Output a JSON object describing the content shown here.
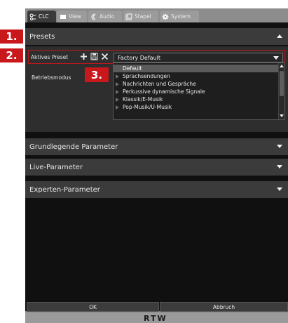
{
  "tabs": [
    {
      "label": "CLC",
      "icon": "clc-icon"
    },
    {
      "label": "View",
      "icon": "monitor-icon"
    },
    {
      "label": "Audio",
      "icon": "audio-icon"
    },
    {
      "label": "Stapel",
      "icon": "stack-icon"
    },
    {
      "label": "System",
      "icon": "gear-icon"
    }
  ],
  "sections": {
    "presets": "Presets",
    "basic": "Grundlegende Parameter",
    "live": "Live-Parameter",
    "expert": "Experten-Parameter"
  },
  "preset": {
    "label": "Aktives Preset",
    "value": "Factory Default"
  },
  "mode": {
    "label": "Betriebsmodus",
    "items": [
      "Default",
      "Sprachsendungen",
      "Nachrichten und Gespräche",
      "Perkussive dynamische Signale",
      "Klassik/E-Musik",
      "Pop-Musik/U-Musik"
    ],
    "selected": "Default"
  },
  "buttons": {
    "ok": "OK",
    "cancel": "Abbruch"
  },
  "markers": [
    "1.",
    "2.",
    "3."
  ],
  "brand": "RTW",
  "colors": {
    "accent_red": "#c8181c",
    "panel_dark": "#101010",
    "section_head": "#3b3b3b"
  }
}
